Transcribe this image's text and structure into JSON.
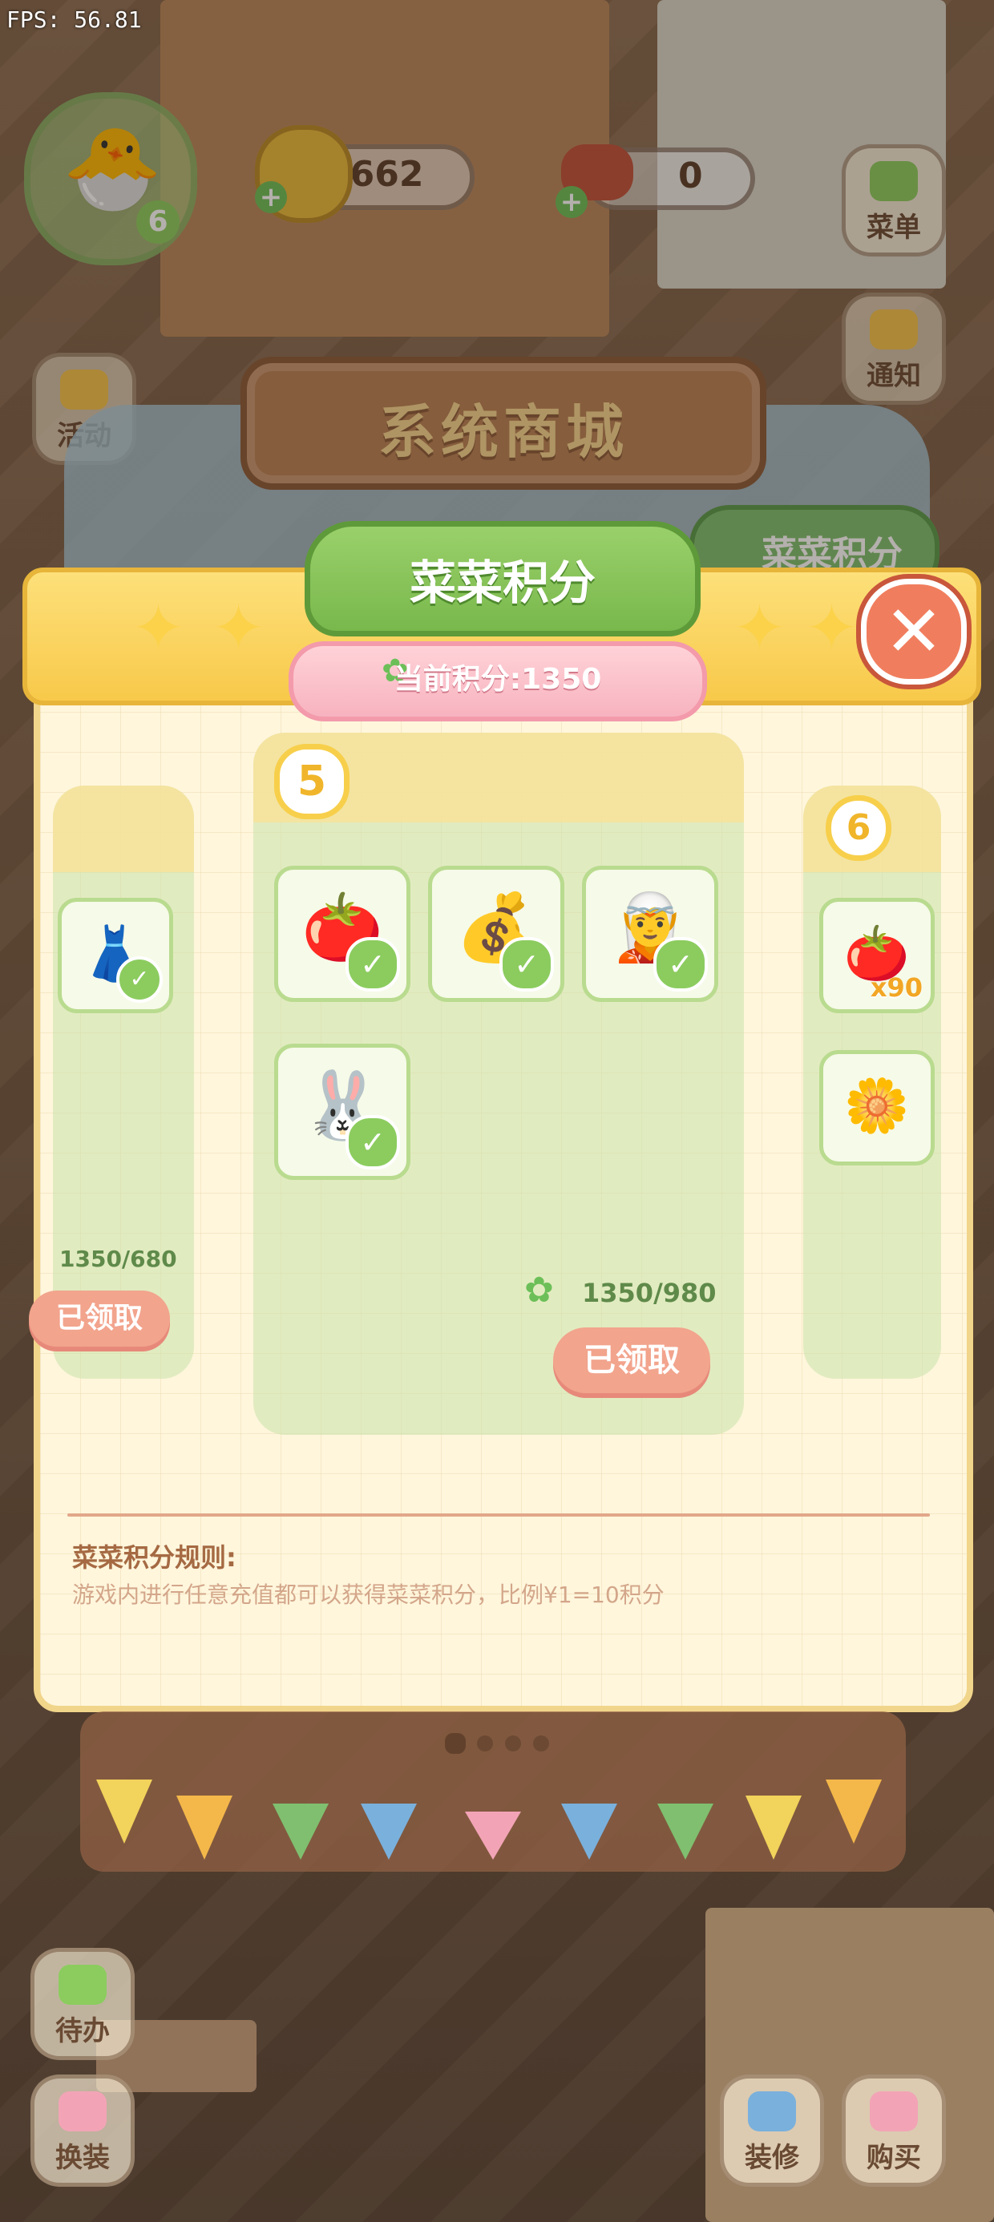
{
  "hud": {
    "fps": "FPS: 56.81",
    "player_level": "6",
    "coins": "1662",
    "currency2": "0",
    "btn_menu": "菜单",
    "btn_notice": "通知",
    "btn_activity": "活动",
    "btn_todo": "待办",
    "btn_outfit": "换装",
    "btn_decorate": "装修",
    "btn_buy": "购买"
  },
  "shop": {
    "title": "系统商城",
    "tab_points": "菜菜积分"
  },
  "modal": {
    "title": "菜菜积分",
    "current_points": "当前积分:1350",
    "close_label": "✕",
    "cards": [
      {
        "tier": "",
        "progress": "1350/680",
        "claim_label": "已领取",
        "items": [
          {
            "icon": "dress-icon",
            "emoji": "👗",
            "claimed": true
          }
        ]
      },
      {
        "tier": "5",
        "progress": "1350/980",
        "claim_label": "已领取",
        "items": [
          {
            "icon": "tomato-basket-icon",
            "emoji": "🍅",
            "claimed": true
          },
          {
            "icon": "gold-coins-icon",
            "emoji": "💰",
            "claimed": true
          },
          {
            "icon": "character-portrait-icon",
            "emoji": "🧝",
            "claimed": true
          },
          {
            "icon": "bunny-decor-icon",
            "emoji": "🐰",
            "claimed": true
          }
        ]
      },
      {
        "tier": "6",
        "progress": "",
        "claim_label": "",
        "items": [
          {
            "icon": "tomato-basket-icon",
            "emoji": "🍅",
            "qty": "x90"
          },
          {
            "icon": "flower-pot-icon",
            "emoji": "🌼"
          }
        ]
      }
    ],
    "rules_title": "菜菜积分规则:",
    "rules_text": "游戏内进行任意充值都可以获得菜菜积分，比例¥1=10积分"
  },
  "pager": {
    "count": 4,
    "active": 0
  },
  "colors": {
    "accent_green": "#78b84c",
    "accent_yellow": "#f8c94a",
    "claim_button": "#f2a48d",
    "close_button": "#f07e5e"
  }
}
